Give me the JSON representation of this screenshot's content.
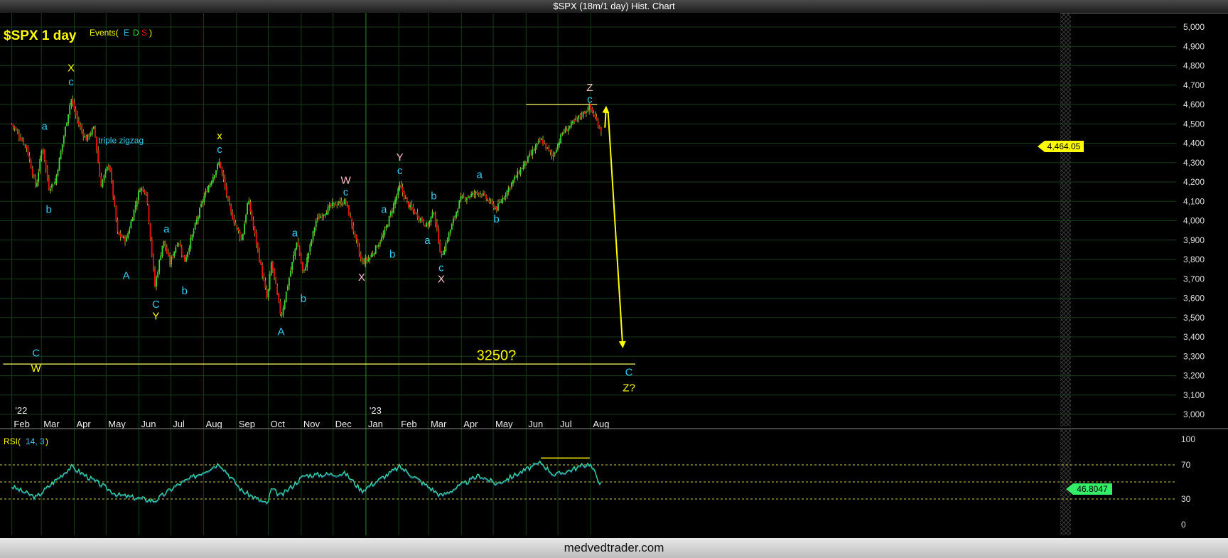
{
  "window": {
    "title": "$SPX (18m/1 day) Hist. Chart"
  },
  "footer": {
    "site": "medvedtrader.com"
  },
  "colors": {
    "background": "#000000",
    "grid": "#173d17",
    "up": "#33dd33",
    "down": "#ee1111",
    "annotation": "#ffff00",
    "wave_cyan": "#33ccee",
    "wave_pink": "#ffbbcc",
    "rsi": "#33dd99"
  },
  "chart_data": [
    {
      "type": "candlestick",
      "title": "$SPX 1 day",
      "events_label": "Events(",
      "events_letters": [
        "E",
        "D",
        "S"
      ],
      "events_close": ")",
      "y_ticks": [
        "5,000",
        "4,900",
        "4,800",
        "4,700",
        "4,600",
        "4,500",
        "4,400",
        "4,300",
        "4,200",
        "4,100",
        "4,000",
        "3,900",
        "3,800",
        "3,700",
        "3,600",
        "3,500",
        "3,400",
        "3,300",
        "3,200",
        "3,100",
        "3,000"
      ],
      "ylim": [
        3000,
        5000
      ],
      "x_ticks": [
        "Feb",
        "Mar",
        "Apr",
        "May",
        "Jun",
        "Jul",
        "Aug",
        "Sep",
        "Oct",
        "Nov",
        "Dec",
        "Jan",
        "Feb",
        "Mar",
        "Apr",
        "May",
        "Jun",
        "Jul",
        "Aug"
      ],
      "year_labels": [
        "'22",
        "'23"
      ],
      "last_price": "4,464.05",
      "price_path": [
        [
          "2022-02-01",
          4500
        ],
        [
          "2022-02-15",
          4380
        ],
        [
          "2022-02-24",
          4170
        ],
        [
          "2022-03-02",
          4390
        ],
        [
          "2022-03-08",
          4170
        ],
        [
          "2022-03-14",
          4200
        ],
        [
          "2022-03-29",
          4631
        ],
        [
          "2022-04-05",
          4500
        ],
        [
          "2022-04-12",
          4420
        ],
        [
          "2022-04-20",
          4480
        ],
        [
          "2022-04-26",
          4180
        ],
        [
          "2022-05-04",
          4300
        ],
        [
          "2022-05-12",
          3930
        ],
        [
          "2022-05-20",
          3900
        ],
        [
          "2022-06-02",
          4170
        ],
        [
          "2022-06-08",
          4150
        ],
        [
          "2022-06-16",
          3660
        ],
        [
          "2022-06-24",
          3900
        ],
        [
          "2022-06-30",
          3780
        ],
        [
          "2022-07-08",
          3900
        ],
        [
          "2022-07-14",
          3790
        ],
        [
          "2022-08-01",
          4120
        ],
        [
          "2022-08-16",
          4305
        ],
        [
          "2022-08-26",
          4050
        ],
        [
          "2022-09-06",
          3900
        ],
        [
          "2022-09-12",
          4110
        ],
        [
          "2022-09-30",
          3590
        ],
        [
          "2022-10-04",
          3790
        ],
        [
          "2022-10-13",
          3500
        ],
        [
          "2022-10-28",
          3900
        ],
        [
          "2022-11-03",
          3720
        ],
        [
          "2022-11-15",
          4000
        ],
        [
          "2022-11-30",
          4080
        ],
        [
          "2022-12-13",
          4100
        ],
        [
          "2022-12-28",
          3783
        ],
        [
          "2023-01-05",
          3810
        ],
        [
          "2023-01-18",
          3930
        ],
        [
          "2023-02-02",
          4180
        ],
        [
          "2023-02-10",
          4080
        ],
        [
          "2023-02-28",
          3970
        ],
        [
          "2023-03-06",
          4050
        ],
        [
          "2023-03-13",
          3810
        ],
        [
          "2023-03-31",
          4110
        ],
        [
          "2023-04-18",
          4150
        ],
        [
          "2023-05-04",
          4060
        ],
        [
          "2023-05-19",
          4200
        ],
        [
          "2023-06-15",
          4420
        ],
        [
          "2023-06-26",
          4330
        ],
        [
          "2023-07-05",
          4450
        ],
        [
          "2023-07-31",
          4588
        ],
        [
          "2023-08-11",
          4464
        ]
      ],
      "future_projection": [
        [
          "2023-08-14",
          4560
        ],
        [
          "2023-08-31",
          3360
        ]
      ],
      "horizontal_levels": [
        {
          "value": 4600,
          "from": "2023-06-01",
          "to": "2023-08-07"
        },
        {
          "value": 3260,
          "from": "2022-01-24",
          "to": "2023-09-12"
        }
      ],
      "annotations": [
        {
          "text": "C",
          "date": "2022-02-24",
          "price": 3300,
          "color": "cyan"
        },
        {
          "text": "W",
          "date": "2022-02-24",
          "price": 3220,
          "color": "yellow"
        },
        {
          "text": "a",
          "date": "2022-03-04",
          "price": 4470,
          "color": "cyan"
        },
        {
          "text": "b",
          "date": "2022-03-08",
          "price": 4040,
          "color": "cyan"
        },
        {
          "text": "X",
          "date": "2022-03-29",
          "price": 4770,
          "color": "yellow"
        },
        {
          "text": "c",
          "date": "2022-03-29",
          "price": 4700,
          "color": "cyan"
        },
        {
          "text": "triple zigzag",
          "date": "2022-05-15",
          "price": 4400,
          "color": "cyan",
          "small": true
        },
        {
          "text": "A",
          "date": "2022-05-20",
          "price": 3700,
          "color": "cyan"
        },
        {
          "text": "C",
          "date": "2022-06-17",
          "price": 3550,
          "color": "cyan"
        },
        {
          "text": "Y",
          "date": "2022-06-17",
          "price": 3490,
          "color": "yellow"
        },
        {
          "text": "a",
          "date": "2022-06-27",
          "price": 3940,
          "color": "cyan"
        },
        {
          "text": "b",
          "date": "2022-07-14",
          "price": 3620,
          "color": "cyan"
        },
        {
          "text": "x",
          "date": "2022-08-16",
          "price": 4420,
          "color": "yellow"
        },
        {
          "text": "c",
          "date": "2022-08-16",
          "price": 4350,
          "color": "cyan"
        },
        {
          "text": "A",
          "date": "2022-10-13",
          "price": 3410,
          "color": "cyan"
        },
        {
          "text": "a",
          "date": "2022-10-26",
          "price": 3920,
          "color": "cyan"
        },
        {
          "text": "b",
          "date": "2022-11-03",
          "price": 3580,
          "color": "cyan"
        },
        {
          "text": "W",
          "date": "2022-12-13",
          "price": 4190,
          "color": "pink"
        },
        {
          "text": "c",
          "date": "2022-12-13",
          "price": 4130,
          "color": "cyan"
        },
        {
          "text": "X",
          "date": "2022-12-28",
          "price": 3690,
          "color": "pink"
        },
        {
          "text": "a",
          "date": "2023-01-18",
          "price": 4040,
          "color": "cyan"
        },
        {
          "text": "b",
          "date": "2023-01-26",
          "price": 3810,
          "color": "cyan"
        },
        {
          "text": "Y",
          "date": "2023-02-02",
          "price": 4310,
          "color": "pink"
        },
        {
          "text": "c",
          "date": "2023-02-02",
          "price": 4240,
          "color": "cyan"
        },
        {
          "text": "a",
          "date": "2023-02-28",
          "price": 3880,
          "color": "cyan"
        },
        {
          "text": "b",
          "date": "2023-03-06",
          "price": 4110,
          "color": "cyan"
        },
        {
          "text": "c",
          "date": "2023-03-13",
          "price": 3740,
          "color": "cyan"
        },
        {
          "text": "X",
          "date": "2023-03-13",
          "price": 3680,
          "color": "pink"
        },
        {
          "text": "a",
          "date": "2023-04-18",
          "price": 4220,
          "color": "cyan"
        },
        {
          "text": "b",
          "date": "2023-05-04",
          "price": 3990,
          "color": "cyan"
        },
        {
          "text": "Z",
          "date": "2023-07-31",
          "price": 4670,
          "color": "pink"
        },
        {
          "text": "c",
          "date": "2023-07-31",
          "price": 4610,
          "color": "cyan"
        },
        {
          "text": "3250?",
          "date": "2023-05-04",
          "price": 3280,
          "color": "yellow",
          "big": true
        },
        {
          "text": "C",
          "date": "2023-09-06",
          "price": 3200,
          "color": "cyan"
        },
        {
          "text": "Z?",
          "date": "2023-09-06",
          "price": 3120,
          "color": "yellow"
        }
      ]
    },
    {
      "type": "line",
      "title": "RSI(",
      "params": "14, 3",
      "params_close": ")",
      "y_ticks": [
        "100",
        "70",
        "30",
        "0"
      ],
      "ylim": [
        0,
        100
      ],
      "levels": [
        70,
        50,
        30
      ],
      "last_value": "46.8047",
      "path": [
        [
          "2022-02-01",
          45
        ],
        [
          "2022-02-24",
          32
        ],
        [
          "2022-03-29",
          68
        ],
        [
          "2022-05-12",
          35
        ],
        [
          "2022-06-16",
          28
        ],
        [
          "2022-07-05",
          45
        ],
        [
          "2022-08-16",
          72
        ],
        [
          "2022-09-06",
          40
        ],
        [
          "2022-09-30",
          24
        ],
        [
          "2022-10-04",
          42
        ],
        [
          "2022-10-13",
          34
        ],
        [
          "2022-11-04",
          58
        ],
        [
          "2022-12-13",
          60
        ],
        [
          "2022-12-28",
          40
        ],
        [
          "2023-02-02",
          68
        ],
        [
          "2023-03-13",
          34
        ],
        [
          "2023-04-18",
          58
        ],
        [
          "2023-05-04",
          48
        ],
        [
          "2023-06-15",
          73
        ],
        [
          "2023-06-28",
          58
        ],
        [
          "2023-07-31",
          72
        ],
        [
          "2023-08-11",
          46.8
        ]
      ],
      "divergence": {
        "from": "2023-06-15",
        "to": "2023-07-31",
        "value": 78
      }
    }
  ]
}
